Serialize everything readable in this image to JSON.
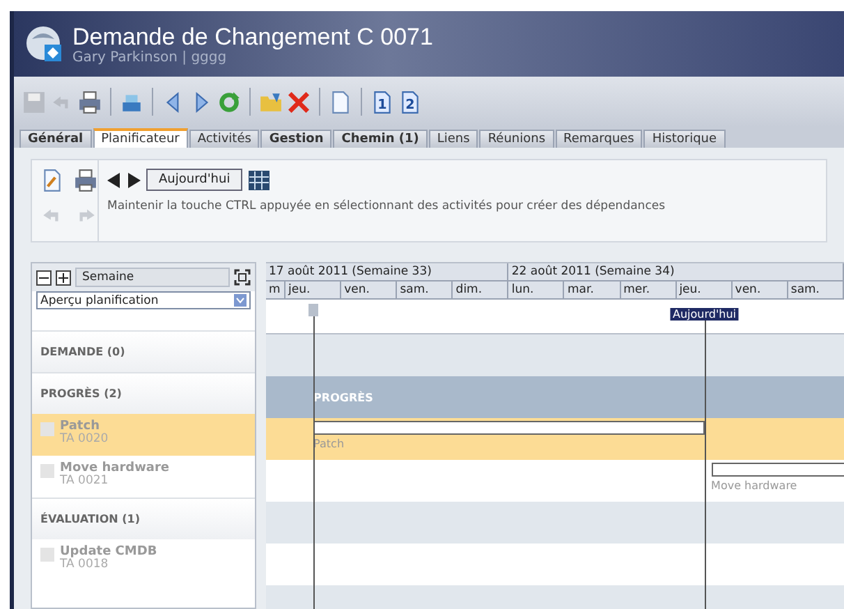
{
  "window": {
    "title": "Demande de Changement C 0071",
    "subtitle": "Gary Parkinson | gggg"
  },
  "toolbar": [
    {
      "kind": "save",
      "disabled": true
    },
    {
      "kind": "undo",
      "disabled": true
    },
    {
      "kind": "print",
      "disabled": false
    },
    {
      "kind": "sep"
    },
    {
      "kind": "stack",
      "disabled": false
    },
    {
      "kind": "sep"
    },
    {
      "kind": "prev",
      "disabled": false
    },
    {
      "kind": "next",
      "disabled": false
    },
    {
      "kind": "refresh",
      "disabled": false
    },
    {
      "kind": "sep"
    },
    {
      "kind": "folder",
      "disabled": false
    },
    {
      "kind": "delete",
      "disabled": false
    },
    {
      "kind": "sep"
    },
    {
      "kind": "page",
      "disabled": false
    },
    {
      "kind": "sep"
    },
    {
      "kind": "numbered",
      "label": "1",
      "disabled": false
    },
    {
      "kind": "numbered",
      "label": "2",
      "disabled": false
    }
  ],
  "tabs": [
    {
      "label": "Général",
      "selected": false,
      "bold": true
    },
    {
      "label": "Planificateur",
      "selected": true,
      "bold": false
    },
    {
      "label": "Activités",
      "selected": false,
      "bold": false
    },
    {
      "label": "Gestion",
      "selected": false,
      "bold": true
    },
    {
      "label": "Chemin (1)",
      "selected": false,
      "bold": true
    },
    {
      "label": "Liens",
      "selected": false,
      "bold": false
    },
    {
      "label": "Réunions",
      "selected": false,
      "bold": false
    },
    {
      "label": "Remarques",
      "selected": false,
      "bold": false
    },
    {
      "label": "Historique",
      "selected": false,
      "bold": false
    }
  ],
  "planner": {
    "today_button": "Aujourd'hui",
    "hint": "Maintenir la touche CTRL appuyée en sélectionnant des activités pour créer des dépendances",
    "undo_disabled": true,
    "redo_disabled": true
  },
  "sidebar": {
    "scale": "Semaine",
    "view": "Aperçu planification",
    "groups": [
      {
        "title": "DEMANDE (0)",
        "band": false
      },
      {
        "title": "PROGRÈS (2)",
        "band": true,
        "band_label": "PROGRÈS",
        "tasks": [
          {
            "name": "Patch",
            "code": "TA 0020",
            "selected": true,
            "bar_label": "Patch"
          },
          {
            "name": "Move hardware",
            "code": "TA 0021",
            "selected": false,
            "bar_label": "Move hardware"
          }
        ]
      },
      {
        "title": "ÉVALUATION (1)",
        "band": false,
        "tasks": [
          {
            "name": "Update CMDB",
            "code": "TA 0018",
            "selected": false
          }
        ]
      }
    ]
  },
  "gantt": {
    "weeks": [
      "17 août 2011 (Semaine 33)",
      "22 août 2011 (Semaine 34)"
    ],
    "days": [
      "m",
      "jeu.",
      "ven.",
      "sam.",
      "dim.",
      "lun.",
      "mar.",
      "mer.",
      "jeu.",
      "ven.",
      "sam."
    ],
    "today_label": "Aujourd'hui"
  }
}
